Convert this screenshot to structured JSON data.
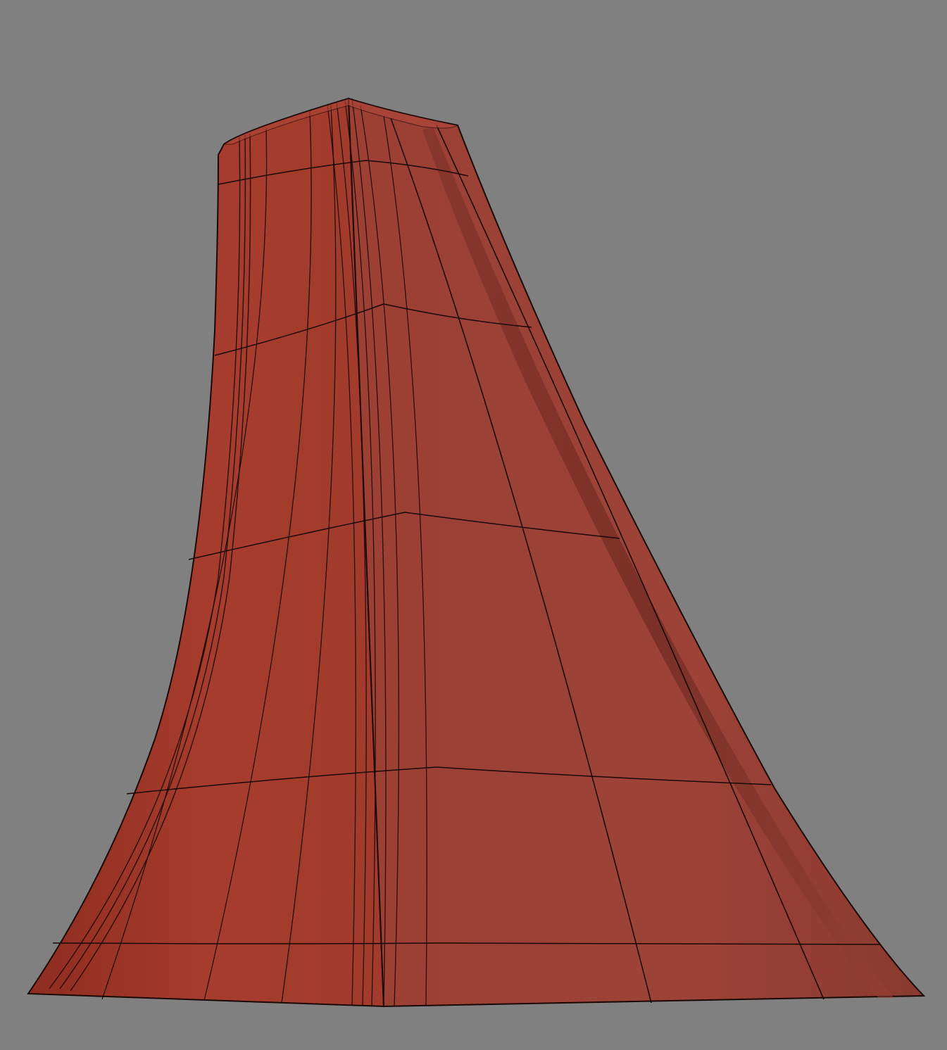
{
  "viewport": {
    "background_color": "#808080"
  },
  "model": {
    "description_icon": "flared-surface-mesh",
    "shading_color": "#a23a2d",
    "edge_color": "#2a0d08"
  }
}
